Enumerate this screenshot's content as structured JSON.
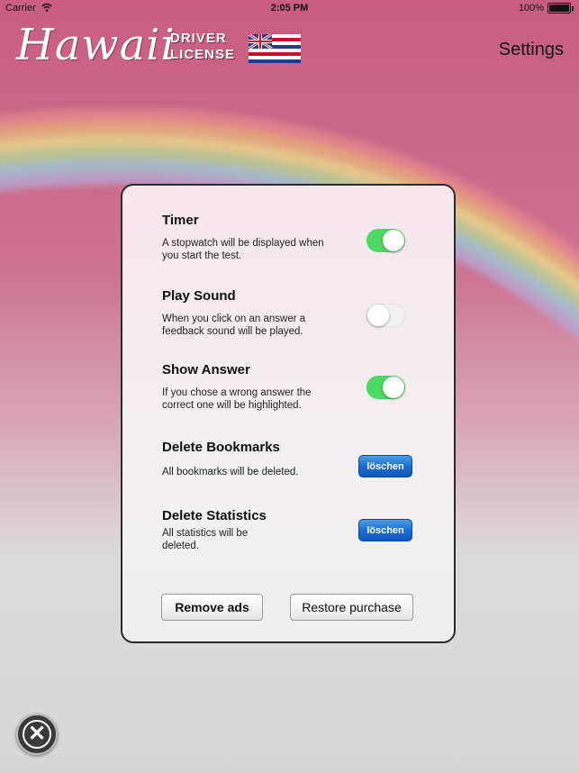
{
  "status_bar": {
    "carrier": "Carrier",
    "time": "2:05 PM",
    "battery": "100%"
  },
  "header": {
    "logo_text": "Hawaii",
    "license_line1": "DRIVER",
    "license_line2": "LICENSE",
    "title": "Settings"
  },
  "settings": {
    "timer": {
      "title": "Timer",
      "desc": "A stopwatch will be displayed when you start the test.",
      "on": true
    },
    "play_sound": {
      "title": "Play Sound",
      "desc": "When you click on an answer a feedback sound will be played.",
      "on": false
    },
    "show_answer": {
      "title": "Show Answer",
      "desc": "If you chose a wrong answer the correct one will be highlighted.",
      "on": true
    },
    "delete_bookmarks": {
      "title": "Delete Bookmarks",
      "desc": "All bookmarks will be deleted.",
      "button": "löschen"
    },
    "delete_statistics": {
      "title": "Delete Statistics",
      "desc": "All statistics will be deleted.",
      "button": "löschen"
    }
  },
  "buttons": {
    "remove_ads": "Remove ads",
    "restore_purchase": "Restore purchase"
  },
  "icons": {
    "close": "close-icon",
    "wifi": "wifi-icon",
    "battery": "battery-icon",
    "flag": "hawaii-flag-icon"
  },
  "colors": {
    "toggle_on": "#4cd964",
    "button_blue": "#1a6ad0",
    "background_pink": "#c95d82"
  }
}
